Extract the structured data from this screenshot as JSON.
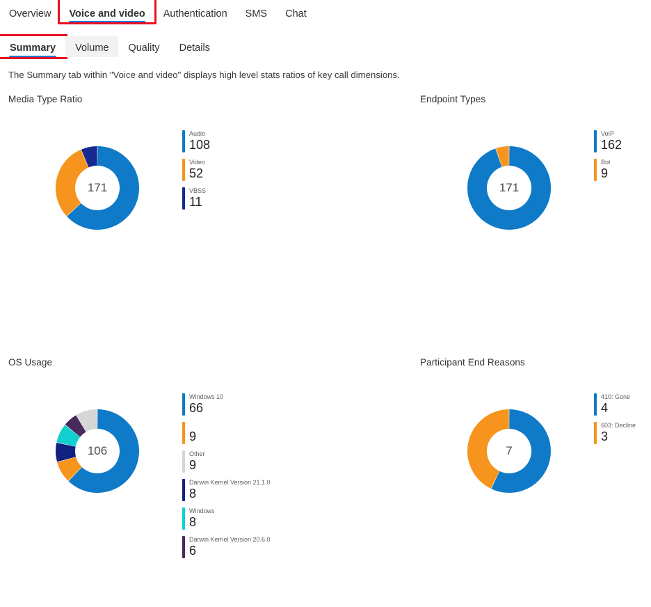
{
  "top_tabs": [
    {
      "label": "Overview",
      "selected": false,
      "highlighted": false
    },
    {
      "label": "Voice and video",
      "selected": true,
      "highlighted": true
    },
    {
      "label": "Authentication",
      "selected": false,
      "highlighted": false
    },
    {
      "label": "SMS",
      "selected": false,
      "highlighted": false
    },
    {
      "label": "Chat",
      "selected": false,
      "highlighted": false
    }
  ],
  "sub_tabs": [
    {
      "label": "Summary",
      "selected": true,
      "highlighted": true,
      "hovered": false
    },
    {
      "label": "Volume",
      "selected": false,
      "highlighted": false,
      "hovered": true
    },
    {
      "label": "Quality",
      "selected": false,
      "highlighted": false,
      "hovered": false
    },
    {
      "label": "Details",
      "selected": false,
      "highlighted": false,
      "hovered": false
    }
  ],
  "description": "The Summary tab within \"Voice and video\" displays high level stats ratios of key call dimensions.",
  "colors": {
    "accent_blue": "#0f7ac8",
    "orange": "#f7941d",
    "navy": "#172a8f",
    "gray": "#d6d6d6",
    "teal": "#0fcfcf",
    "purple": "#4a2a5c",
    "dark_navy": "#11217f",
    "highlight_red": "#e81123",
    "tab_underline": "#0078d4"
  },
  "chart_data": [
    {
      "type": "pie",
      "title": "Media Type Ratio",
      "center_label": "171",
      "total": 171,
      "categories": [
        "Audio",
        "Video",
        "VBSS"
      ],
      "values": [
        108,
        52,
        11
      ],
      "colors": [
        "#0f7ac8",
        "#f7941d",
        "#172a8f"
      ],
      "legend_position": "right"
    },
    {
      "type": "pie",
      "title": "Endpoint Types",
      "center_label": "171",
      "total": 171,
      "categories": [
        "VoIP",
        "Bot"
      ],
      "values": [
        162,
        9
      ],
      "colors": [
        "#0f7ac8",
        "#f7941d"
      ],
      "legend_position": "right"
    },
    {
      "type": "pie",
      "title": "OS Usage",
      "center_label": "106",
      "total": 106,
      "categories": [
        "Windows 10",
        "",
        "Other",
        "Darwin Kernel Version 21.1.0",
        "Windows",
        "Darwin Kernel Version 20.6.0"
      ],
      "values": [
        66,
        9,
        9,
        8,
        8,
        6
      ],
      "colors": [
        "#0f7ac8",
        "#f7941d",
        "#d6d6d6",
        "#11217f",
        "#0fcfcf",
        "#4a2a5c"
      ],
      "slice_order": [
        "#0f7ac8",
        "#f7941d",
        "#11217f",
        "#0fcfcf",
        "#4a2a5c",
        "#d6d6d6"
      ],
      "slice_values": [
        66,
        9,
        8,
        8,
        6,
        9
      ],
      "legend_position": "right"
    },
    {
      "type": "pie",
      "title": "Participant End Reasons",
      "center_label": "7",
      "total": 7,
      "categories": [
        "410: Gone",
        "603: Decline"
      ],
      "values": [
        4,
        3
      ],
      "colors": [
        "#0f7ac8",
        "#f7941d"
      ],
      "legend_position": "right"
    }
  ]
}
